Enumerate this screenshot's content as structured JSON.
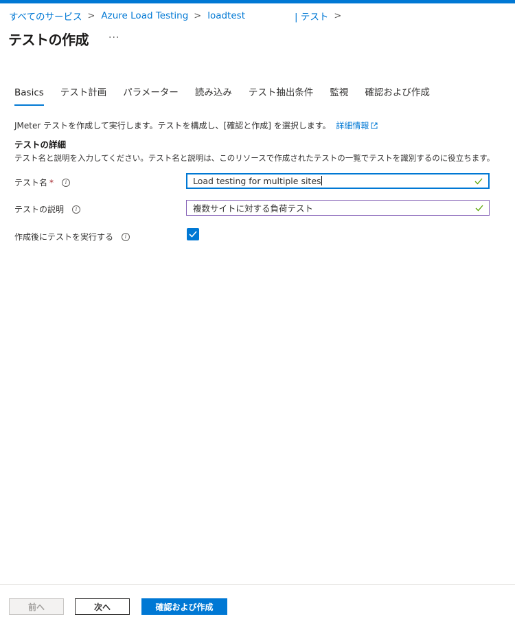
{
  "breadcrumb": {
    "items": [
      "すべてのサービス",
      "Azure Load Testing",
      "loadtest",
      "| テスト"
    ],
    "separator": ">"
  },
  "page": {
    "title": "テストの作成",
    "more_label": "···"
  },
  "tabs": [
    {
      "label": "Basics",
      "active": true
    },
    {
      "label": "テスト計画",
      "active": false
    },
    {
      "label": "パラメーター",
      "active": false
    },
    {
      "label": "読み込み",
      "active": false
    },
    {
      "label": "テスト抽出条件",
      "active": false
    },
    {
      "label": "監視",
      "active": false
    },
    {
      "label": "確認および作成",
      "active": false
    }
  ],
  "intro": {
    "text": "JMeter テストを作成して実行します。テストを構成し、[確認と作成] を選択します。",
    "link": "詳細情報"
  },
  "details": {
    "title": "テストの詳細",
    "description": "テスト名と説明を入力してください。テスト名と説明は、このリソースで作成されたテストの一覧でテストを識別するのに役立ちます。"
  },
  "form": {
    "test_name_label": "テスト名",
    "required_mark": "*",
    "test_name_value": "Load testing for multiple sites",
    "test_desc_label": "テストの説明",
    "test_desc_value": "複数サイトに対する負荷テスト",
    "run_after_label": "作成後にテストを実行する",
    "run_after_checked": true
  },
  "footer": {
    "prev": "前へ",
    "next": "次へ",
    "create": "確認および作成"
  },
  "colors": {
    "accent": "#0078d4",
    "valid": "#57a300",
    "required": "#a4262c"
  }
}
